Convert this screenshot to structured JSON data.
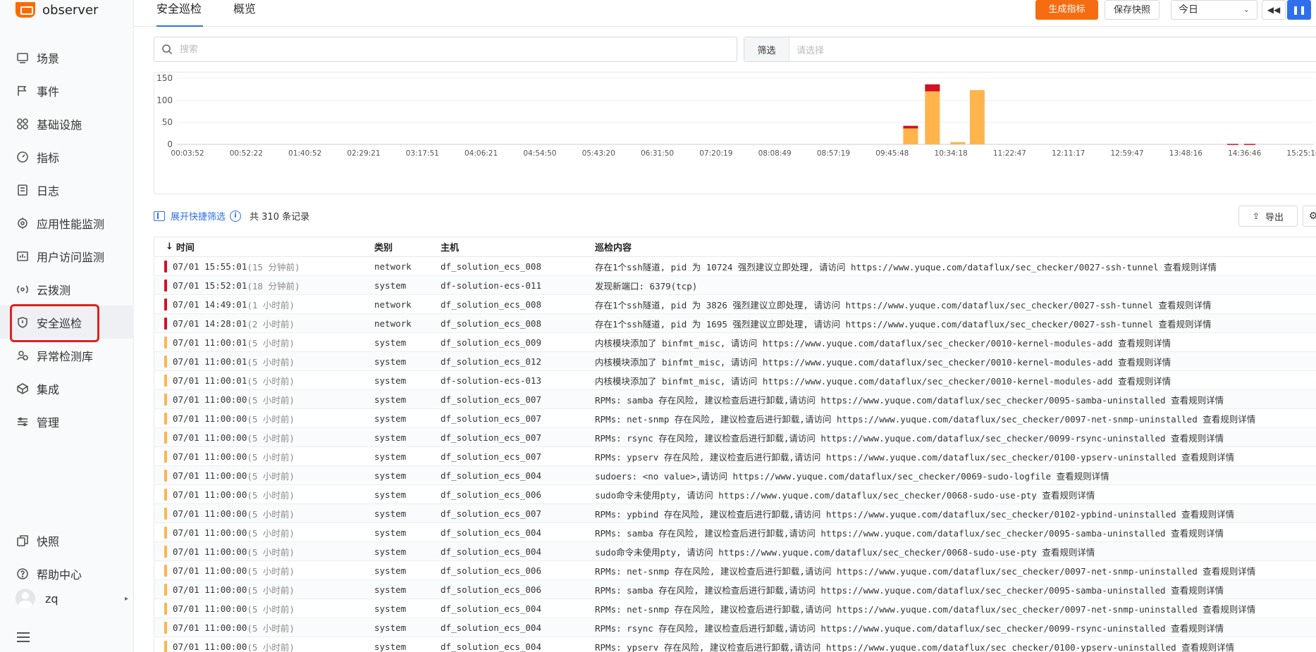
{
  "app": {
    "name": "observer",
    "brand_color": "#f56c12"
  },
  "sidebar": {
    "items": [
      {
        "label": "场景",
        "icon": "dashboard-icon"
      },
      {
        "label": "事件",
        "icon": "flag-icon"
      },
      {
        "label": "基础设施",
        "icon": "infrastructure-icon"
      },
      {
        "label": "指标",
        "icon": "metrics-icon"
      },
      {
        "label": "日志",
        "icon": "log-icon"
      },
      {
        "label": "应用性能监测",
        "icon": "apm-icon"
      },
      {
        "label": "用户访问监测",
        "icon": "rum-icon"
      },
      {
        "label": "云拨测",
        "icon": "dialing-icon"
      },
      {
        "label": "安全巡检",
        "icon": "shield-icon",
        "active": true
      },
      {
        "label": "异常检测库",
        "icon": "monitor-icon"
      },
      {
        "label": "集成",
        "icon": "integration-icon"
      },
      {
        "label": "管理",
        "icon": "settings-icon"
      }
    ],
    "bottom": [
      {
        "label": "快照",
        "icon": "snapshot-icon"
      },
      {
        "label": "帮助中心",
        "icon": "help-icon"
      }
    ],
    "user": "zq"
  },
  "header": {
    "tabs": [
      "安全巡检",
      "概览"
    ],
    "generate_metric": "生成指标",
    "save_snapshot": "保存快照",
    "time_range": "今日"
  },
  "search": {
    "placeholder": "搜索"
  },
  "filter": {
    "label": "筛选",
    "placeholder": "请选择"
  },
  "toolbar": {
    "quick_filter": "展开快捷筛选",
    "count": "共 310 条记录",
    "export": "导出"
  },
  "chart_data": {
    "type": "bar",
    "stacked": true,
    "x_ticks": [
      "00:03:52",
      "00:52:22",
      "01:40:52",
      "02:29:21",
      "03:17:51",
      "04:06:21",
      "04:54:50",
      "05:43:20",
      "06:31:50",
      "07:20:19",
      "08:08:49",
      "08:57:19",
      "09:45:48",
      "10:34:18",
      "11:22:47",
      "12:11:17",
      "12:59:47",
      "13:48:16",
      "14:36:46",
      "15:25:16"
    ],
    "y_ticks": [
      0,
      50,
      100,
      150
    ],
    "ylim": [
      0,
      150
    ],
    "colors": {
      "warning": "#ffb44c",
      "critical": "#cf1322"
    },
    "bars": [
      {
        "x": "10:01",
        "warning": 36,
        "critical": 6
      },
      {
        "x": "10:19",
        "warning": 120,
        "critical": 16
      },
      {
        "x": "10:40",
        "warning": 5,
        "critical": 0
      },
      {
        "x": "10:56",
        "warning": 123,
        "critical": 0
      },
      {
        "x": "14:27",
        "warning": 0,
        "critical": 1
      },
      {
        "x": "14:41",
        "warning": 0,
        "critical": 1
      },
      {
        "x": "15:55",
        "warning": 0,
        "critical": 2
      }
    ]
  },
  "table": {
    "columns": [
      "时间",
      "类别",
      "主机",
      "巡检内容"
    ],
    "severity_colors": {
      "critical": "#cf1322",
      "warning": "#ffb44c"
    },
    "rows": [
      {
        "sev": "critical",
        "time": "07/01 15:55:01",
        "rel": "(15 分钟前)",
        "type": "network",
        "host": "df_solution_ecs_008",
        "content": "存在1个ssh隧道, pid 为 10724 强烈建议立即处理, 请访问 https://www.yuque.com/dataflux/sec_checker/0027-ssh-tunnel",
        "link": "查看规则详情"
      },
      {
        "sev": "critical",
        "time": "07/01 15:52:01",
        "rel": "(18 分钟前)",
        "type": "system",
        "host": "df-solution-ecs-011",
        "content": "发现新端口: 6379(tcp)",
        "link": ""
      },
      {
        "sev": "critical",
        "time": "07/01 14:49:01",
        "rel": "(1 小时前)",
        "type": "network",
        "host": "df_solution_ecs_008",
        "content": "存在1个ssh隧道, pid 为 3826 强烈建议立即处理, 请访问 https://www.yuque.com/dataflux/sec_checker/0027-ssh-tunnel",
        "link": "查看规则详情"
      },
      {
        "sev": "critical",
        "time": "07/01 14:28:01",
        "rel": "(2 小时前)",
        "type": "network",
        "host": "df_solution_ecs_008",
        "content": "存在1个ssh隧道, pid 为 1695 强烈建议立即处理, 请访问 https://www.yuque.com/dataflux/sec_checker/0027-ssh-tunnel",
        "link": "查看规则详情"
      },
      {
        "sev": "warning",
        "time": "07/01 11:00:01",
        "rel": "(5 小时前)",
        "type": "system",
        "host": "df_solution_ecs_009",
        "content": "内核模块添加了 binfmt_misc, 请访问 https://www.yuque.com/dataflux/sec_checker/0010-kernel-modules-add",
        "link": "查看规则详情"
      },
      {
        "sev": "warning",
        "time": "07/01 11:00:01",
        "rel": "(5 小时前)",
        "type": "system",
        "host": "df_solution_ecs_012",
        "content": "内核模块添加了 binfmt_misc, 请访问 https://www.yuque.com/dataflux/sec_checker/0010-kernel-modules-add",
        "link": "查看规则详情"
      },
      {
        "sev": "warning",
        "time": "07/01 11:00:01",
        "rel": "(5 小时前)",
        "type": "system",
        "host": "df-solution-ecs-013",
        "content": "内核模块添加了 binfmt_misc, 请访问 https://www.yuque.com/dataflux/sec_checker/0010-kernel-modules-add",
        "link": "查看规则详情"
      },
      {
        "sev": "warning",
        "time": "07/01 11:00:00",
        "rel": "(5 小时前)",
        "type": "system",
        "host": "df_solution_ecs_007",
        "content": "RPMs: samba 存在风险, 建议检查后进行卸载,请访问 https://www.yuque.com/dataflux/sec_checker/0095-samba-uninstalled",
        "link": "查看规则详情"
      },
      {
        "sev": "warning",
        "time": "07/01 11:00:00",
        "rel": "(5 小时前)",
        "type": "system",
        "host": "df_solution_ecs_007",
        "content": "RPMs: net-snmp 存在风险, 建议检查后进行卸载,请访问 https://www.yuque.com/dataflux/sec_checker/0097-net-snmp-uninstalled",
        "link": "查看规则详情"
      },
      {
        "sev": "warning",
        "time": "07/01 11:00:00",
        "rel": "(5 小时前)",
        "type": "system",
        "host": "df_solution_ecs_007",
        "content": "RPMs: rsync 存在风险, 建议检查后进行卸载,请访问 https://www.yuque.com/dataflux/sec_checker/0099-rsync-uninstalled",
        "link": "查看规则详情"
      },
      {
        "sev": "warning",
        "time": "07/01 11:00:00",
        "rel": "(5 小时前)",
        "type": "system",
        "host": "df_solution_ecs_007",
        "content": "RPMs: ypserv 存在风险, 建议检查后进行卸载,请访问 https://www.yuque.com/dataflux/sec_checker/0100-ypserv-uninstalled",
        "link": "查看规则详情"
      },
      {
        "sev": "warning",
        "time": "07/01 11:00:00",
        "rel": "(5 小时前)",
        "type": "system",
        "host": "df_solution_ecs_004",
        "content": "sudoers: <no value>,请访问 https://www.yuque.com/dataflux/sec_checker/0069-sudo-logfile",
        "link": "查看规则详情"
      },
      {
        "sev": "warning",
        "time": "07/01 11:00:00",
        "rel": "(5 小时前)",
        "type": "system",
        "host": "df_solution_ecs_006",
        "content": "sudo命令未使用pty, 请访问 https://www.yuque.com/dataflux/sec_checker/0068-sudo-use-pty",
        "link": "查看规则详情"
      },
      {
        "sev": "warning",
        "time": "07/01 11:00:00",
        "rel": "(5 小时前)",
        "type": "system",
        "host": "df_solution_ecs_007",
        "content": "RPMs: ypbind 存在风险, 建议检查后进行卸载,请访问 https://www.yuque.com/dataflux/sec_checker/0102-ypbind-uninstalled",
        "link": "查看规则详情"
      },
      {
        "sev": "warning",
        "time": "07/01 11:00:00",
        "rel": "(5 小时前)",
        "type": "system",
        "host": "df_solution_ecs_004",
        "content": "RPMs: samba 存在风险, 建议检查后进行卸载,请访问 https://www.yuque.com/dataflux/sec_checker/0095-samba-uninstalled",
        "link": "查看规则详情"
      },
      {
        "sev": "warning",
        "time": "07/01 11:00:00",
        "rel": "(5 小时前)",
        "type": "system",
        "host": "df_solution_ecs_004",
        "content": "sudo命令未使用pty, 请访问 https://www.yuque.com/dataflux/sec_checker/0068-sudo-use-pty",
        "link": "查看规则详情"
      },
      {
        "sev": "warning",
        "time": "07/01 11:00:00",
        "rel": "(5 小时前)",
        "type": "system",
        "host": "df_solution_ecs_006",
        "content": "RPMs: net-snmp 存在风险, 建议检查后进行卸载,请访问 https://www.yuque.com/dataflux/sec_checker/0097-net-snmp-uninstalled",
        "link": "查看规则详情"
      },
      {
        "sev": "warning",
        "time": "07/01 11:00:00",
        "rel": "(5 小时前)",
        "type": "system",
        "host": "df_solution_ecs_006",
        "content": "RPMs: samba 存在风险, 建议检查后进行卸载,请访问 https://www.yuque.com/dataflux/sec_checker/0095-samba-uninstalled",
        "link": "查看规则详情"
      },
      {
        "sev": "warning",
        "time": "07/01 11:00:00",
        "rel": "(5 小时前)",
        "type": "system",
        "host": "df_solution_ecs_004",
        "content": "RPMs: net-snmp 存在风险, 建议检查后进行卸载,请访问 https://www.yuque.com/dataflux/sec_checker/0097-net-snmp-uninstalled",
        "link": "查看规则详情"
      },
      {
        "sev": "warning",
        "time": "07/01 11:00:00",
        "rel": "(5 小时前)",
        "type": "system",
        "host": "df_solution_ecs_004",
        "content": "RPMs: rsync 存在风险, 建议检查后进行卸载,请访问 https://www.yuque.com/dataflux/sec_checker/0099-rsync-uninstalled",
        "link": "查看规则详情"
      },
      {
        "sev": "warning",
        "time": "07/01 11:00:00",
        "rel": "(5 小时前)",
        "type": "system",
        "host": "df_solution_ecs_004",
        "content": "RPMs: ypserv 存在风险, 建议检查后进行卸载,请访问 https://www.yuque.com/dataflux/sec_checker/0100-ypserv-uninstalled",
        "link": "查看规则详情"
      }
    ]
  }
}
